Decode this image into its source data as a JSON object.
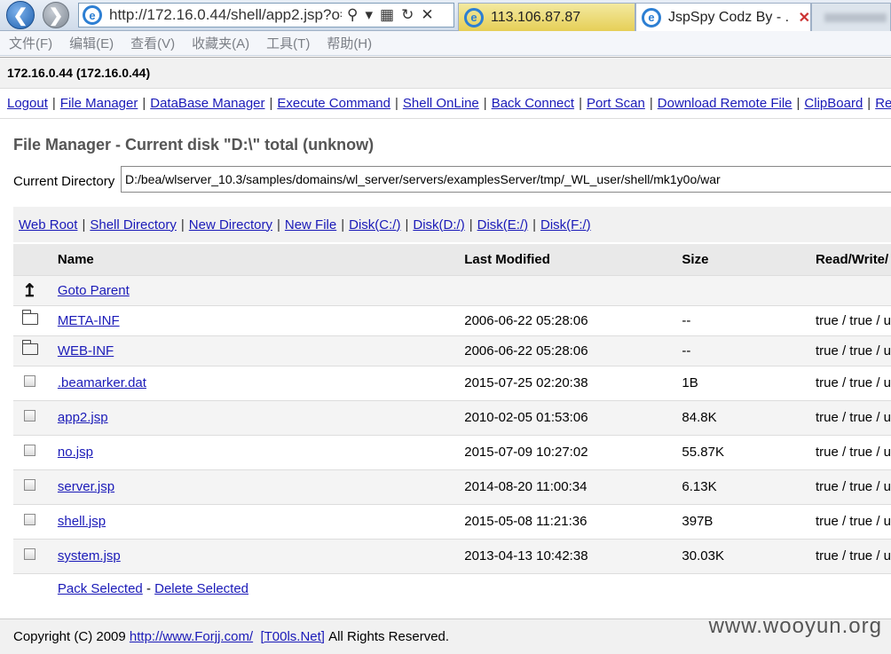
{
  "browser": {
    "url": "http://172.16.0.44/shell/app2.jsp?o=",
    "tabs": [
      {
        "label": "113.106.87.87"
      },
      {
        "label": "JspSpy Codz By - ..."
      }
    ],
    "menu": [
      "文件(F)",
      "编辑(E)",
      "查看(V)",
      "收藏夹(A)",
      "工具(T)",
      "帮助(H)"
    ]
  },
  "host": "172.16.0.44 (172.16.0.44)",
  "nav_links": [
    "Logout",
    "File Manager",
    "DataBase Manager",
    "Execute Command",
    "Shell OnLine",
    "Back Connect",
    "Port Scan",
    "Download Remote File",
    "ClipBoard",
    "Remote C"
  ],
  "file_manager": {
    "title": "File Manager - Current disk \"D:\\\" total (unknow)",
    "current_dir_label": "Current Directory",
    "current_dir": "D:/bea/wlserver_10.3/samples/domains/wl_server/servers/examplesServer/tmp/_WL_user/shell/mk1y0o/war",
    "quick_links": [
      "Web Root",
      "Shell Directory",
      "New Directory",
      "New File",
      "Disk(C:/)",
      "Disk(D:/)",
      "Disk(E:/)",
      "Disk(F:/)"
    ],
    "columns": [
      "Name",
      "Last Modified",
      "Size",
      "Read/Write/"
    ],
    "parent_label": "Goto Parent",
    "entries": [
      {
        "kind": "dir",
        "name": "META-INF",
        "modified": "2006-06-22 05:28:06",
        "size": "--",
        "perm": "true / true / u"
      },
      {
        "kind": "dir",
        "name": "WEB-INF",
        "modified": "2006-06-22 05:28:06",
        "size": "--",
        "perm": "true / true / u"
      },
      {
        "kind": "file",
        "name": ".beamarker.dat",
        "modified": "2015-07-25 02:20:38",
        "size": "1B",
        "perm": "true / true / u"
      },
      {
        "kind": "file",
        "name": "app2.jsp",
        "modified": "2010-02-05 01:53:06",
        "size": "84.8K",
        "perm": "true / true / u"
      },
      {
        "kind": "file",
        "name": "no.jsp",
        "modified": "2015-07-09 10:27:02",
        "size": "55.87K",
        "perm": "true / true / u"
      },
      {
        "kind": "file",
        "name": "server.jsp",
        "modified": "2014-08-20 11:00:34",
        "size": "6.13K",
        "perm": "true / true / u"
      },
      {
        "kind": "file",
        "name": "shell.jsp",
        "modified": "2015-05-08 11:21:36",
        "size": "397B",
        "perm": "true / true / u"
      },
      {
        "kind": "file",
        "name": "system.jsp",
        "modified": "2013-04-13 10:42:38",
        "size": "30.03K",
        "perm": "true / true / u"
      }
    ],
    "pack_selected": "Pack Selected",
    "delete_selected": "Delete Selected"
  },
  "footer": {
    "copyright": "Copyright (C) 2009",
    "link1": "http://www.Forjj.com/",
    "link2": "[T00ls.Net]",
    "rights": "All Rights Reserved."
  },
  "watermark": "www.wooyun.org"
}
